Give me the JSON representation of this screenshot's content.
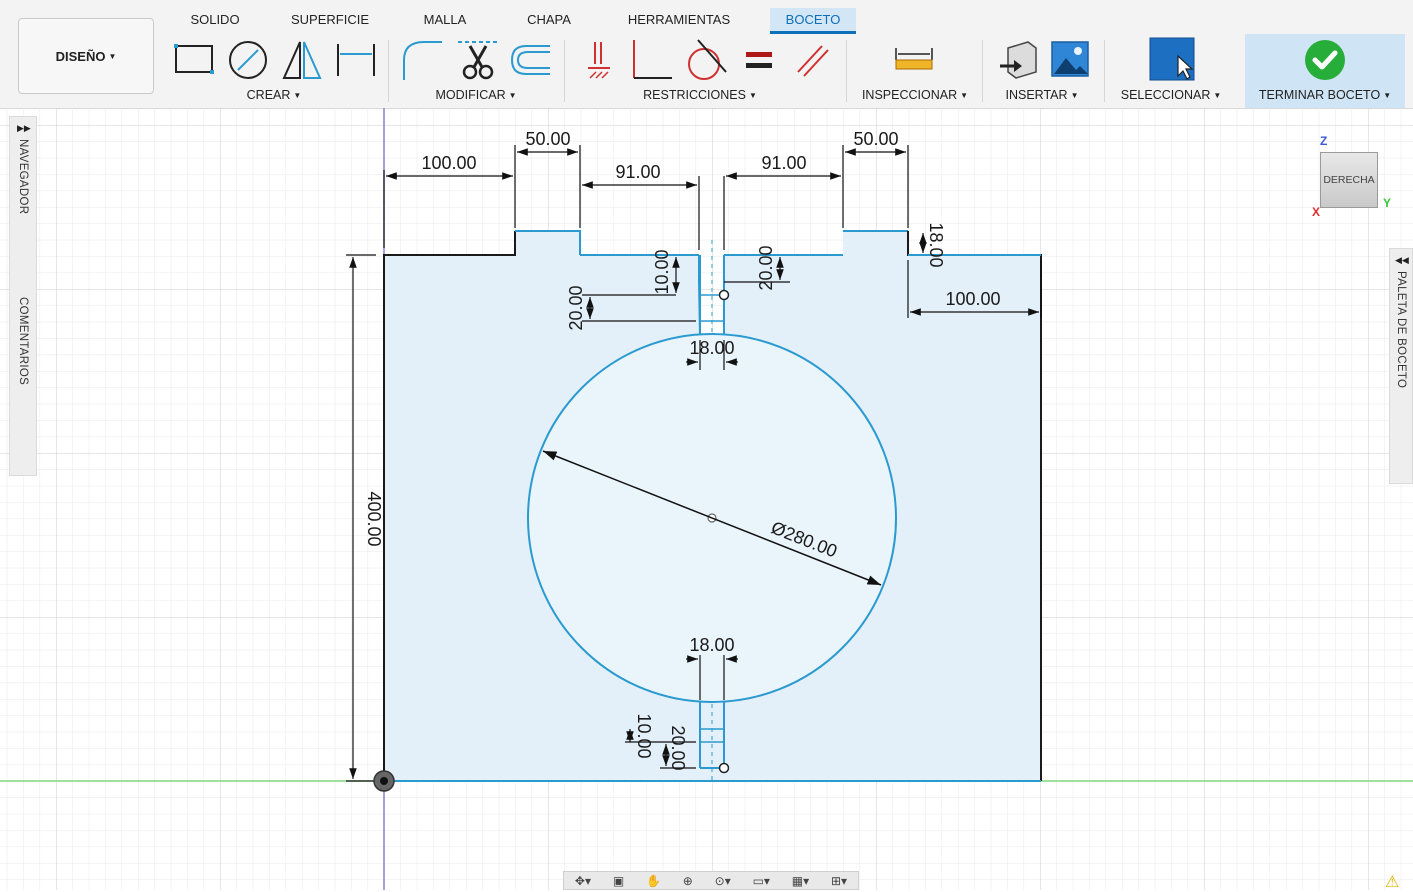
{
  "tabs": [
    "SOLIDO",
    "SUPERFICIE",
    "MALLA",
    "CHAPA",
    "HERRAMIENTAS",
    "BOCETO"
  ],
  "active_tab": "BOCETO",
  "design_button": "DISEÑO",
  "groups": {
    "crear": "CREAR",
    "modificar": "MODIFICAR",
    "restricciones": "RESTRICCIONES",
    "inspeccionar": "INSPECCIONAR",
    "insertar": "INSERTAR",
    "seleccionar": "SELECCIONAR",
    "terminar": "TERMINAR BOCETO"
  },
  "panels": {
    "navegador": "NAVEGADOR",
    "comentarios": "COMENTARIOS",
    "paleta": "PALETA DE BOCETO"
  },
  "viewcube": {
    "face": "DERECHA",
    "axis_z": "Z",
    "axis_x": "X",
    "axis_y": "Y"
  },
  "dimensions": {
    "d_left_width": "100.00",
    "d_left_step": "50.00",
    "d_left_gap": "91.00",
    "d_right_gap": "91.00",
    "d_right_step": "50.00",
    "d_right_step_height": "18.00",
    "d_right_width": "100.00",
    "d_slot_top_depth": "10.00",
    "d_slot_top_len": "20.00",
    "d_slot_top_len2": "20.00",
    "d_slot_top_width": "18.00",
    "d_circle": "Ø280.00",
    "d_height": "400.00",
    "d_slot_bot_width": "18.00",
    "d_slot_bot_depth": "10.00",
    "d_slot_bot_len": "20.00"
  },
  "colors": {
    "accent": "#0d6fb8",
    "sketch_line": "#2a9ad0",
    "profile_fill": "#e3f0f9",
    "finish_check": "#27ae3a",
    "x_axis": "#e03030",
    "y_axis": "#37c837"
  }
}
